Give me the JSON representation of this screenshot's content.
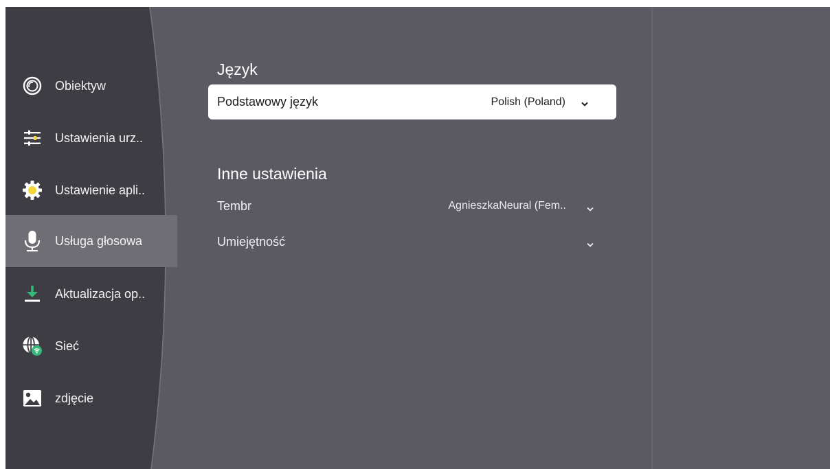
{
  "colors": {
    "background": "#5b5a62",
    "sidebar": "#3e3d43",
    "sidebar_active": "#6f6e75",
    "card": "#ffffff",
    "accent_green": "#35b77a",
    "accent_yellow": "#f4d63a"
  },
  "sidebar": {
    "items": [
      {
        "label": "Obiektyw",
        "icon": "lens-icon"
      },
      {
        "label": "Ustawienia urz..",
        "icon": "sliders-icon"
      },
      {
        "label": "Ustawienie apli..",
        "icon": "gear-icon"
      },
      {
        "label": "Usługa głosowa",
        "icon": "microphone-icon",
        "selected": true
      },
      {
        "label": "Aktualizacja op..",
        "icon": "download-icon"
      },
      {
        "label": "Sieć",
        "icon": "globe-wifi-icon"
      },
      {
        "label": "zdjęcie",
        "icon": "image-icon"
      }
    ]
  },
  "language": {
    "title": "Język",
    "primary": {
      "label": "Podstawowy język",
      "value": "Polish (Poland)"
    }
  },
  "other": {
    "title": "Inne ustawienia",
    "tembr": {
      "label": "Tembr",
      "value": "AgnieszkaNeural (Fem.."
    },
    "skill": {
      "label": "Umiejętność",
      "value": ""
    }
  }
}
